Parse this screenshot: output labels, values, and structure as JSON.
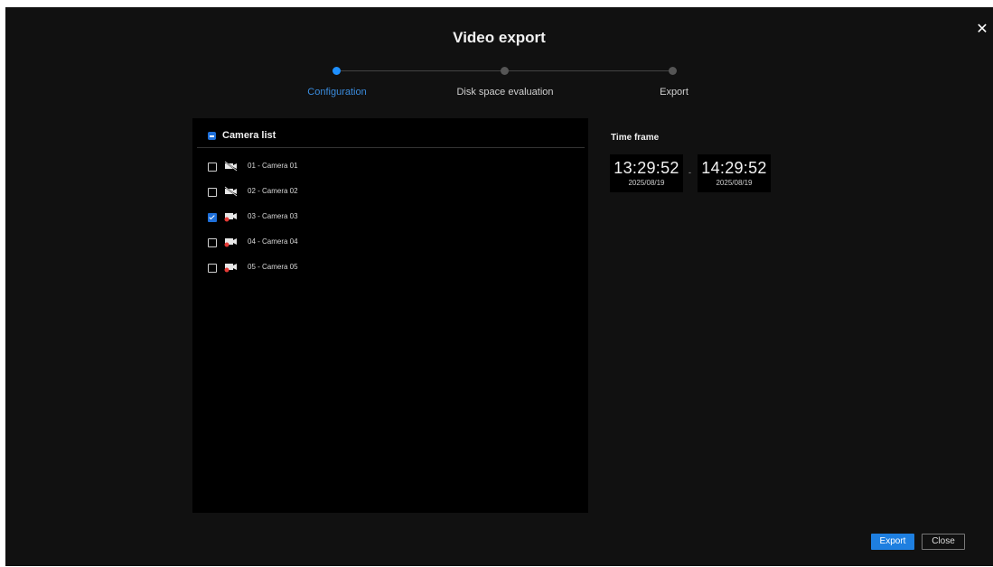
{
  "dialog": {
    "title": "Video export",
    "close_icon": "close-icon"
  },
  "stepper": {
    "steps": [
      {
        "label": "Configuration",
        "active": true
      },
      {
        "label": "Disk space evaluation",
        "active": false
      },
      {
        "label": "Export",
        "active": false
      }
    ]
  },
  "camera_list": {
    "header_label": "Camera list",
    "header_state": "partial",
    "cameras": [
      {
        "name": "01 - Camera 01",
        "checked": false,
        "icon": "camera-offline-icon"
      },
      {
        "name": "02 - Camera 02",
        "checked": false,
        "icon": "camera-offline-icon"
      },
      {
        "name": "03 - Camera 03",
        "checked": true,
        "icon": "camera-recording-icon"
      },
      {
        "name": "04 - Camera 04",
        "checked": false,
        "icon": "camera-recording-icon"
      },
      {
        "name": "05 - Camera 05",
        "checked": false,
        "icon": "camera-recording-icon"
      }
    ]
  },
  "time_frame": {
    "title": "Time frame",
    "start": {
      "time": "13:29:52",
      "date": "2025/08/19"
    },
    "end": {
      "time": "14:29:52",
      "date": "2025/08/19"
    },
    "separator": "-"
  },
  "buttons": {
    "export_label": "Export",
    "close_label": "Close"
  },
  "colors": {
    "accent": "#1e7fe0",
    "background": "#111111",
    "panel": "#000000"
  }
}
